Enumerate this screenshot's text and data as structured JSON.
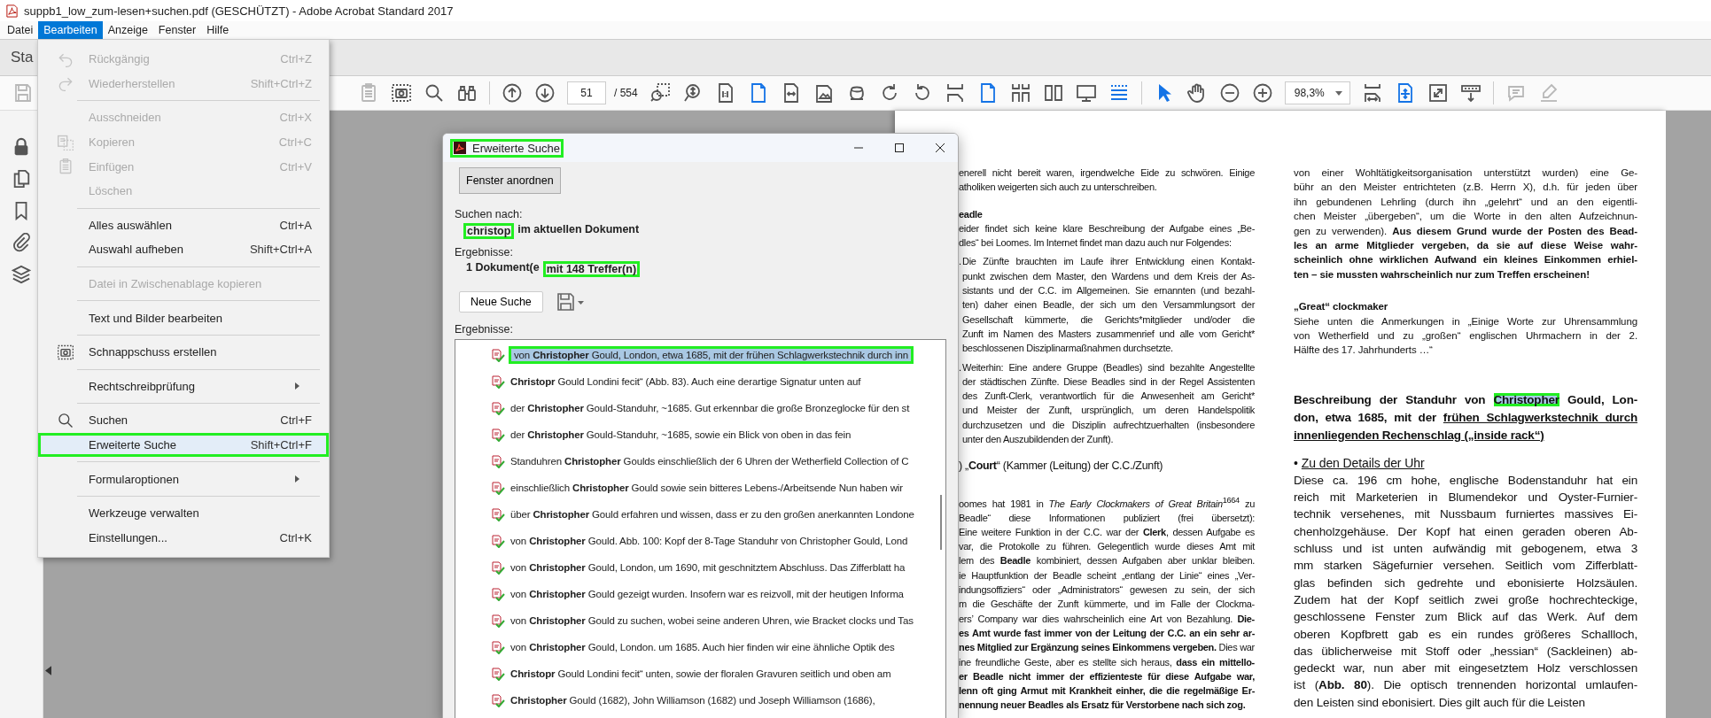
{
  "window": {
    "title": "suppb1_low_zum-lesen+suchen.pdf (GESCHÜTZT) - Adobe Acrobat Standard 2017"
  },
  "menubar": [
    {
      "label": "Datei",
      "selected": false
    },
    {
      "label": "Bearbeiten",
      "selected": true
    },
    {
      "label": "Anzeige",
      "selected": false
    },
    {
      "label": "Fenster",
      "selected": false
    },
    {
      "label": "Hilfe",
      "selected": false
    }
  ],
  "tab": {
    "label": "Sta"
  },
  "toolbar": [
    {
      "kind": "button",
      "disabled": true
    },
    {
      "kind": "gap"
    },
    {
      "kind": "button",
      "disabled": true
    },
    {
      "kind": "button",
      "selected": false,
      "disabled": false
    },
    {
      "kind": "button",
      "selected": false,
      "disabled": false
    },
    {
      "kind": "button",
      "selected": false,
      "disabled": false
    },
    {
      "kind": "separator"
    },
    {
      "kind": "button",
      "selected": false,
      "disabled": false
    },
    {
      "kind": "button",
      "selected": false,
      "disabled": false
    },
    {
      "kind": "page-field",
      "value": "51",
      "total": "/ 554"
    },
    {
      "kind": "button",
      "selected": false,
      "disabled": false
    },
    {
      "kind": "button",
      "selected": false,
      "disabled": false
    },
    {
      "kind": "button",
      "selected": false,
      "disabled": false
    },
    {
      "kind": "button",
      "selected": true,
      "disabled": false
    },
    {
      "kind": "button",
      "selected": false,
      "disabled": false
    },
    {
      "kind": "button",
      "selected": false,
      "disabled": false
    },
    {
      "kind": "button",
      "selected": false,
      "disabled": false
    },
    {
      "kind": "button",
      "selected": false,
      "disabled": false
    },
    {
      "kind": "button",
      "selected": false,
      "disabled": false
    },
    {
      "kind": "button",
      "selected": false,
      "disabled": false
    },
    {
      "kind": "button",
      "selected": true,
      "disabled": false
    },
    {
      "kind": "button",
      "selected": false,
      "disabled": false
    },
    {
      "kind": "button",
      "selected": false,
      "disabled": false
    },
    {
      "kind": "button",
      "selected": false,
      "disabled": false
    },
    {
      "kind": "button",
      "selected": true,
      "disabled": false
    },
    {
      "kind": "separator"
    },
    {
      "kind": "button",
      "selected": true,
      "disabled": false
    },
    {
      "kind": "button",
      "selected": false,
      "disabled": false
    },
    {
      "kind": "button",
      "selected": false,
      "disabled": false
    },
    {
      "kind": "button",
      "selected": false,
      "disabled": false
    },
    {
      "kind": "zoom-field",
      "value": "98,3%"
    },
    {
      "kind": "button",
      "selected": false,
      "disabled": false
    },
    {
      "kind": "button",
      "selected": true,
      "disabled": false
    },
    {
      "kind": "button",
      "selected": false,
      "disabled": false
    },
    {
      "kind": "button",
      "selected": false,
      "disabled": false
    },
    {
      "kind": "separator"
    },
    {
      "kind": "button",
      "disabled": true
    },
    {
      "kind": "button",
      "disabled": true
    }
  ],
  "menu": [
    {
      "kind": "item",
      "label": "Rückgängig",
      "shortcut": "Ctrl+Z",
      "disabled": true,
      "selected": false
    },
    {
      "kind": "item",
      "label": "Wiederherstellen",
      "shortcut": "Shift+Ctrl+Z",
      "disabled": true,
      "selected": false
    },
    {
      "kind": "separator"
    },
    {
      "kind": "item",
      "label": "Ausschneiden",
      "shortcut": "Ctrl+X",
      "disabled": true,
      "selected": false
    },
    {
      "kind": "item",
      "label": "Kopieren",
      "shortcut": "Ctrl+C",
      "disabled": true,
      "selected": false
    },
    {
      "kind": "item",
      "label": "Einfügen",
      "shortcut": "Ctrl+V",
      "disabled": true,
      "selected": false
    },
    {
      "kind": "item",
      "label": "Löschen",
      "disabled": true,
      "selected": false
    },
    {
      "kind": "separator"
    },
    {
      "kind": "item",
      "label": "Alles auswählen",
      "shortcut": "Ctrl+A",
      "disabled": false,
      "selected": false
    },
    {
      "kind": "item",
      "label": "Auswahl aufheben",
      "shortcut": "Shift+Ctrl+A",
      "disabled": false,
      "selected": false
    },
    {
      "kind": "separator"
    },
    {
      "kind": "item",
      "label": "Datei in Zwischenablage kopieren",
      "disabled": true,
      "selected": false
    },
    {
      "kind": "separator"
    },
    {
      "kind": "item",
      "label": "Text und Bilder bearbeiten",
      "disabled": false,
      "selected": false
    },
    {
      "kind": "separator"
    },
    {
      "kind": "item",
      "label": "Schnappschuss erstellen",
      "disabled": false,
      "selected": false
    },
    {
      "kind": "separator"
    },
    {
      "kind": "item",
      "label": "Rechtschreibprüfung",
      "submenu": true,
      "disabled": false,
      "selected": false
    },
    {
      "kind": "separator"
    },
    {
      "kind": "item",
      "label": "Suchen",
      "shortcut": "Ctrl+F",
      "disabled": false,
      "selected": false
    },
    {
      "kind": "item",
      "label": "Erweiterte Suche",
      "shortcut": "Shift+Ctrl+F",
      "disabled": false,
      "selected": true,
      "annotated": true
    },
    {
      "kind": "separator"
    },
    {
      "kind": "item",
      "label": "Formularoptionen",
      "submenu": true,
      "disabled": false,
      "selected": false
    },
    {
      "kind": "separator"
    },
    {
      "kind": "item",
      "label": "Werkzeuge verwalten",
      "disabled": false,
      "selected": false
    },
    {
      "kind": "item",
      "label": "Einstellungen...",
      "shortcut": "Ctrl+K",
      "disabled": false,
      "selected": false
    }
  ],
  "search": {
    "title": "Erweiterte Suche",
    "title_annotated": true,
    "arrange_button": "Fenster anordnen",
    "query_label": "Suchen nach:",
    "query_term": "christop",
    "query_annotated": true,
    "query_scope": "im aktuellen Dokument",
    "summary_label": "Ergebnisse:",
    "summary_docs": "1 Dokument(e",
    "summary_hits": "mit 148 Treffer(n)",
    "summary_annotated": true,
    "new_search_button": "Neue Suche",
    "results_label": "Ergebnisse:",
    "results": [
      {
        "text": "von **Christopher** Gould, London, etwa 1685, mit der frühen Schlagwerkstechnik durch inn",
        "selected": true,
        "annotated": true
      },
      {
        "text": "**Christopr** Gould Londini fecit“ (Abb. 83). Auch eine derartige Signatur unten auf",
        "selected": false,
        "annotated": false
      },
      {
        "text": "der **Christopher** Gould-Standuhr, ~1685. Gut erkennbar die große Bronzeglocke für den st",
        "selected": false,
        "annotated": false
      },
      {
        "text": "der **Christopher** Gould-Standuhr, ~1685, sowie ein Blick von oben in das fein",
        "selected": false,
        "annotated": false
      },
      {
        "text": "Standuhren **Christopher** Goulds einschließlich der 6 Uhren der Wetherfield Collection of C",
        "selected": false,
        "annotated": false
      },
      {
        "text": "einschließlich **Christopher** Gould sowie sein bitteres Lebens-/Arbeitsende Nun haben wir",
        "selected": false,
        "annotated": false
      },
      {
        "text": "über **Christopher** Gould erfahren und wissen, dass er zu den großen anerkannten Londone",
        "selected": false,
        "annotated": false
      },
      {
        "text": "von **Christopher** Gould. Abb. 100: Kopf der 8-Tage Standuhr von Christopher Gould, Lond",
        "selected": false,
        "annotated": false
      },
      {
        "text": "von **Christopher** Gould, London, um 1690, mit geschnitztem Abschluss. Das Zifferblatt ha",
        "selected": false,
        "annotated": false
      },
      {
        "text": "von **Christopher** Gould gezeigt wurden. Insofern war es reizvoll, mit der heutigen Informa",
        "selected": false,
        "annotated": false
      },
      {
        "text": "von **Christopher** Gould zu suchen, wobei seine anderen Uhren, wie Bracket clocks und Tas",
        "selected": false,
        "annotated": false
      },
      {
        "text": "von **Christopher** Gould, London. um 1685. Auch hier finden wir eine ähnliche Optik des",
        "selected": false,
        "annotated": false
      },
      {
        "text": "**Christopr** Gould Londini fecit“ unten, sowie der floralen Gravuren seitlich und oben am",
        "selected": false,
        "annotated": false
      },
      {
        "text": "**Christopher** Gould (1682), John Williamson (1682) und Joseph Williamson (1686),",
        "selected": false,
        "annotated": false
      }
    ]
  },
  "document": {
    "columns": [
      {
        "blocks": [
          {
            "kind": "para",
            "lines": [
              "enerell nicht bereit waren, irgendwelche Eide zu schwören. Einige",
              "atholiken weigerten sich auch zu unterschreiben."
            ]
          },
          {
            "kind": "heading",
            "lines": [
              "eadle"
            ]
          },
          {
            "kind": "para",
            "lines": [
              "eider findet sich keine klare Beschreibung der Aufgabe eines „Be-",
              "dles“ bei Loomes. Im Internet findet man dazu auch nur Folgendes:"
            ]
          },
          {
            "kind": "item",
            "marker": ".",
            "lines": [
              "Die Zünfte brauchten im Laufe ihrer Entwicklung einen Kontakt-",
              "punkt zwischen dem Master, den Wardens und dem Kreis der As-",
              "sistants und der C.C. im Allgemeinen. Sie ernannten (und bezahl-",
              "ten) daher einen Beadle, der sich um den Versammlungsort der",
              "Gesellschaft kümmerte, die Gerichts*mitglieder und/oder die",
              "Zunft im Namen des Masters zusammenrief und alle vom Gericht*",
              "beschlossenen Disziplinarmaßnahmen durchsetzte."
            ]
          },
          {
            "kind": "item",
            "marker": ".",
            "lines": [
              "Weiterhin: Eine andere Gruppe (Beadles) sind bezahlte Angestellte",
              "der städtischen Zünfte. Diese Beadles sind in der Regel Assistenten",
              "des Zunft-Clerk, verantwortlich für die Anwesenheit am Gericht*",
              "und Meister der Zunft, ursprünglich, um deren Handelspolitik",
              "durchzusetzen und die Disziplin aufrechtzuerhalten (insbesondere",
              "unter den Auszubildenden der Zunft)."
            ]
          },
          {
            "kind": "subheading",
            "lines": [
              ") „**Court**“ (Kammer (Leitung) der C.C./Zunft)"
            ]
          },
          {
            "kind": "source",
            "lines": [
              "oomes hat 1981 in *The Early Clockmakers of Great Britain*$^{1664}$ zu",
              "Beadle“ diese Informationen publiziert (frei übersetzt):",
              "Eine weitere Funktion in der C.C. war der **Clerk**, dessen Aufgabe es",
              "var, die Protokolle zu führen. Gelegentlich wurde dieses Amt mit",
              "lem des **Beadle** kombiniert, dessen Aufgaben aber unklar bleiben.",
              "ie Hauptfunktion der Beadle scheint „entlang der Linie“ eines „Ver-",
              "indungsoffiziers“ oder „Administrators“ gewesen zu sein, der sich",
              "m die Geschäfte der Zunft kümmerte, und im Falle der Clockma-",
              "ers’ Company war dies wahrscheinlich eine Art von Bezahlung. **Die-**",
              "**es Amt wurde fast immer von der Leitung der C.C. an ein sehr ar-**",
              "**nes Mitglied zur Ergänzung seines Einkommens vergeben.** Dies war",
              "ine freundliche Geste, aber es stellte sich heraus, **dass ein mittello-**",
              "**er Beadle nicht immer der effizienteste für diese Aufgabe war,**",
              "**lenn oft ging Armut mit Krankheit einher, die die regelmäßige Er-**",
              "**nennung neuer Beadles als Ersatz für Verstorbene nach sich zog.**"
            ]
          }
        ]
      },
      {
        "blocks": [
          {
            "kind": "para",
            "lines": [
              "von einer Wohltätigkeitsorganisation unterstützt wurden) eine Ge-",
              "bühr an den Meister entrichteten (z.B. Herrn X), d.h. für jeden über",
              "ihn gebundenen Lehrling (durch ihn „gelehrt“ und an den eigentli-",
              "chen Meister „übergeben“, um die Worte in den alten Aufzeichnun-",
              "gen zu verwenden). **Aus diesem Grund wurde der Posten des Bead-**",
              "**les an arme Mitglieder vergeben, da sie auf diese Weise wahr-**",
              "**scheinlich ohne wirklichen Aufwand ein kleines Einkommen erhiel-**",
              "**ten – sie mussten wahrscheinlich nur zum Treffen erscheinen!**"
            ]
          },
          {
            "kind": "heading",
            "lines": [
              "„Great“ clockmaker"
            ]
          },
          {
            "kind": "para",
            "lines": [
              "Siehe unten die Anmerkungen in „Einige Worte zur Uhrensammlung",
              "von Wetherfield und zu „großen“ englischen Uhrmachern in der 2.",
              "Hälfte des 17. Jahrhunderts …“"
            ]
          },
          {
            "kind": "title",
            "lines": [
              [
                {
                  "text": "Beschreibung der Standuhr von "
                },
                {
                  "text": "Christopher",
                  "hit": true,
                  "annotated": true
                },
                {
                  "text": " Gould, Lon-"
                }
              ],
              [
                {
                  "text": "don, etwa 1685, mit der "
                },
                {
                  "text": "frühen Schlagwerkstechnik durch",
                  "underline": true
                }
              ],
              [
                {
                  "text": "innenliegenden Rechenschlag („inside rack“)",
                  "underline": true
                }
              ]
            ]
          },
          {
            "kind": "bullet",
            "marker": "•",
            "lines": [
              "Zu den Details der Uhr"
            ]
          },
          {
            "kind": "body",
            "lines": [
              "Diese ca. 196 cm hohe, englische Bodenstanduhr hat ein",
              "reich mit Marketerien in Blumendekor und Oyster-Furnier-",
              "technik versehenes, mit Nussbaum furniertes massives Ei-",
              "chenholzgehäuse. Der Kopf hat einen geraden oberen Ab-",
              "schluss und ist unten aufwändig mit gebogenem, etwa 3",
              "mm starken Sägefurnier versehen. Seitlich vom Zifferblatt-",
              "glas befinden sich gedrehte und ebonisierte Holzsäulen.",
              "Zudem hat der Kopf seitlich zwei große hochrechteckige,",
              "geschlossene Fenster zum Blick auf das Werk. Auf dem",
              "oberen Kopfbrett gab es ein rundes größeres Schallloch,",
              "das üblicherweise mit Stoff oder „hessian“ (Sackleinen) ab-",
              "gedeckt war, nun aber mit eingesetztem Holz verschlossen",
              "ist (**Abb. 80**). Die optisch trennenden horizontal umlaufen-",
              "den Leisten sind ebonisiert. Dies gilt auch für die Leisten"
            ]
          }
        ]
      }
    ]
  }
}
